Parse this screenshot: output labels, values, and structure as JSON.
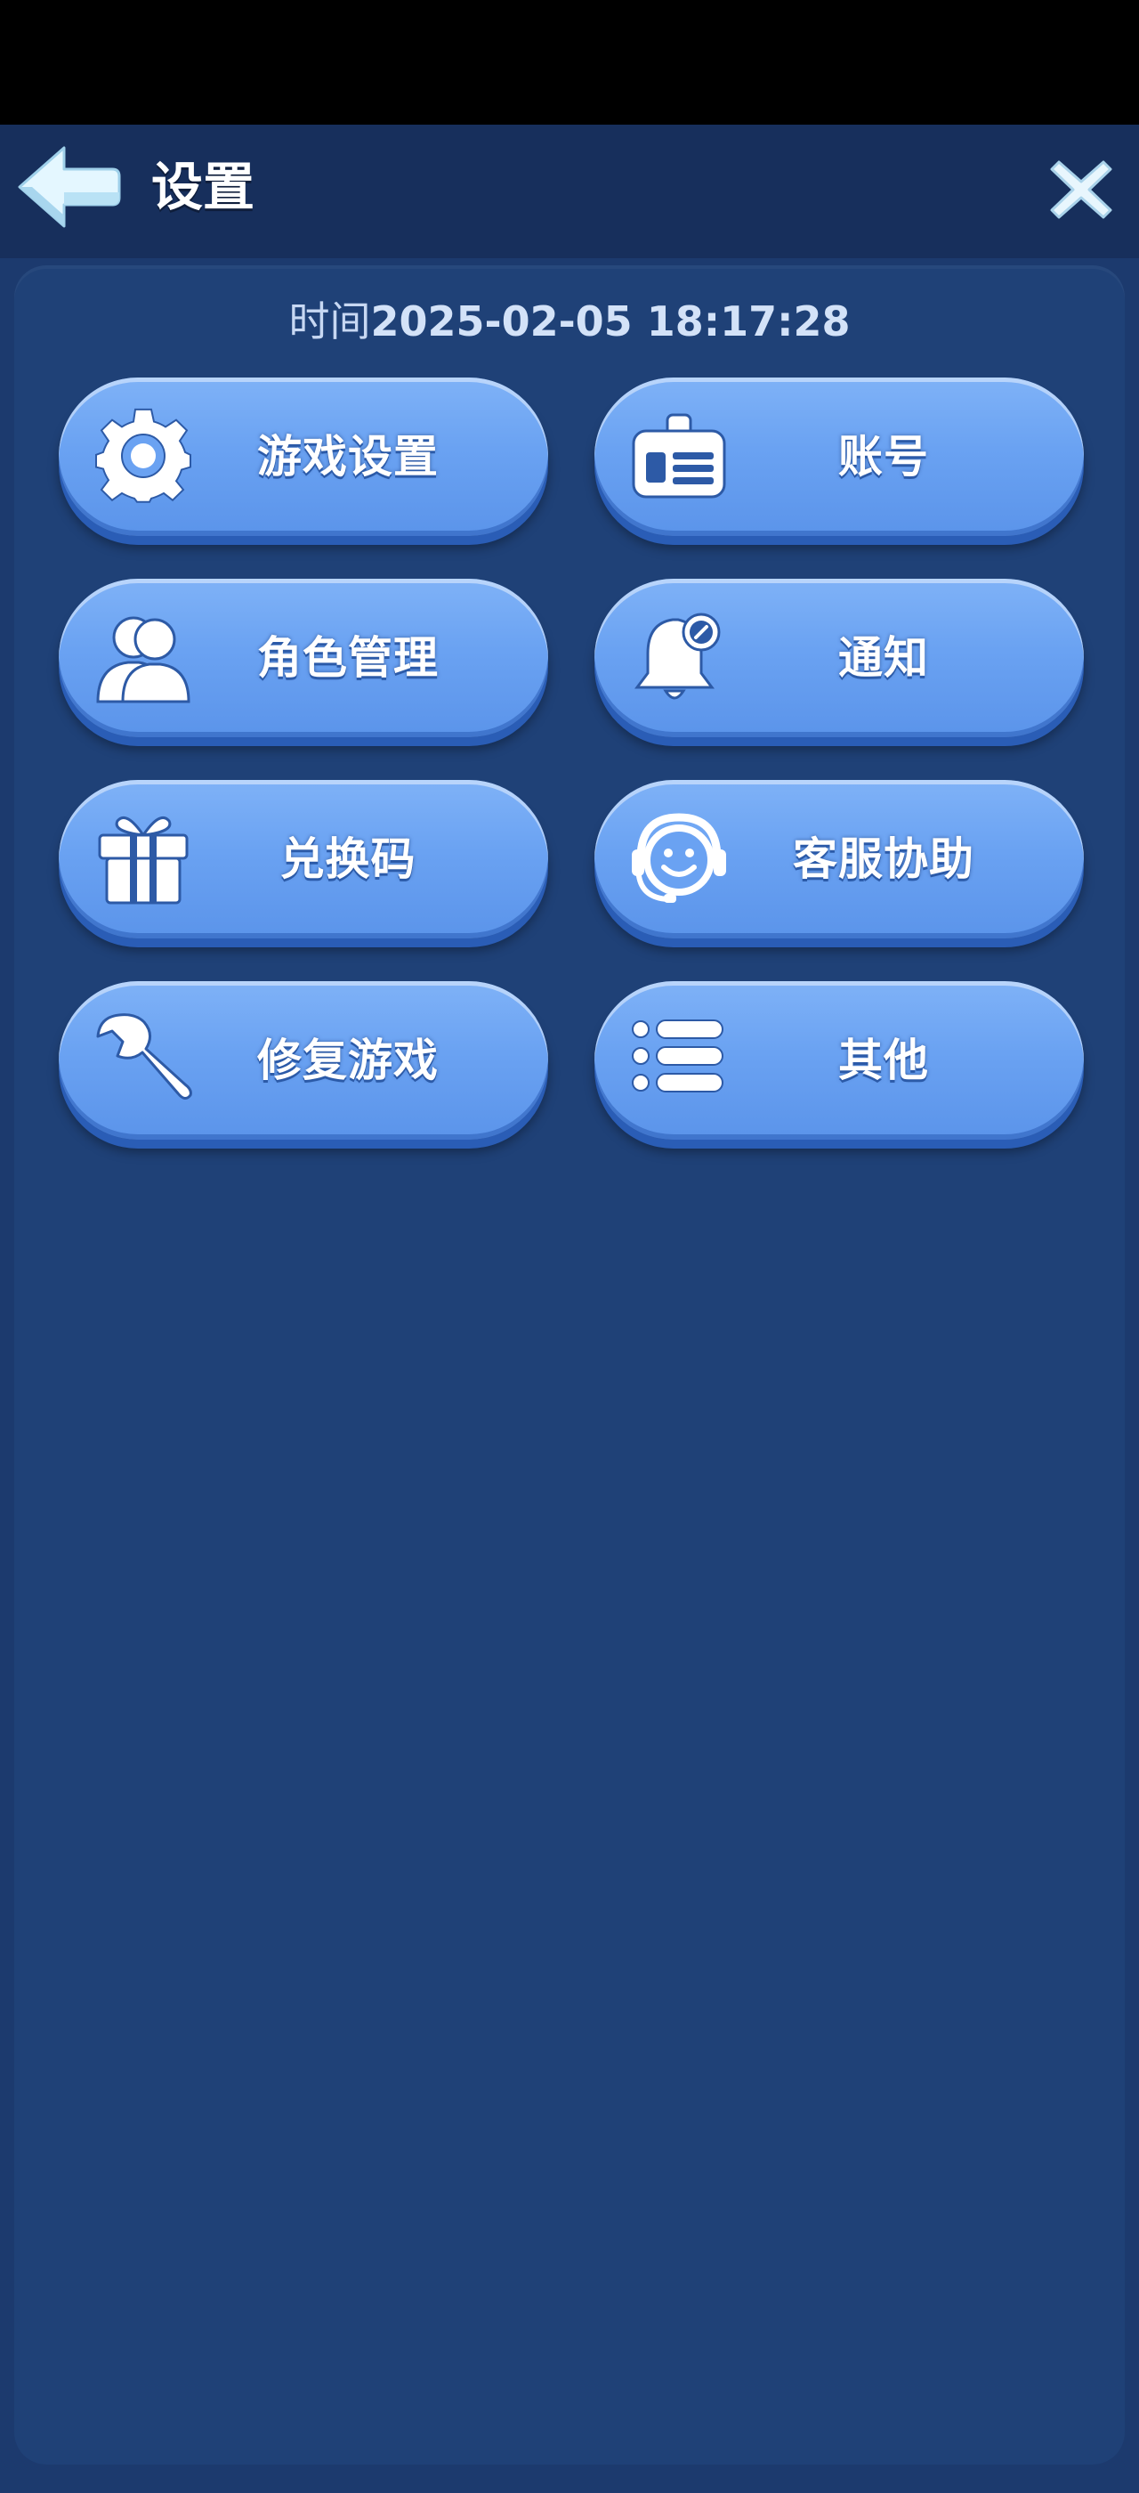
{
  "header": {
    "title": "设置"
  },
  "panel": {
    "time_label": "时间",
    "time_value": "2025-02-05 18:17:28"
  },
  "menu": {
    "game_settings": "游戏设置",
    "account": "账号",
    "character_management": "角色管理",
    "notifications": "通知",
    "redeem_code": "兑换码",
    "customer_service": "客服协助",
    "repair_game": "修复游戏",
    "other": "其他"
  },
  "icons": {
    "back": "back-arrow-icon",
    "close": "close-icon",
    "game_settings": "gear-icon",
    "account": "id-card-icon",
    "character_management": "users-icon",
    "notifications": "bell-icon",
    "redeem_code": "gift-icon",
    "customer_service": "headset-icon",
    "repair_game": "wrench-icon",
    "other": "list-icon"
  },
  "colors": {
    "background": "#1c3a6e",
    "topbar": "#172f5c",
    "panel": "#1f4177",
    "button": "#6aa2f2",
    "button_shadow": "#2a5db6",
    "text": "#ffffff"
  }
}
